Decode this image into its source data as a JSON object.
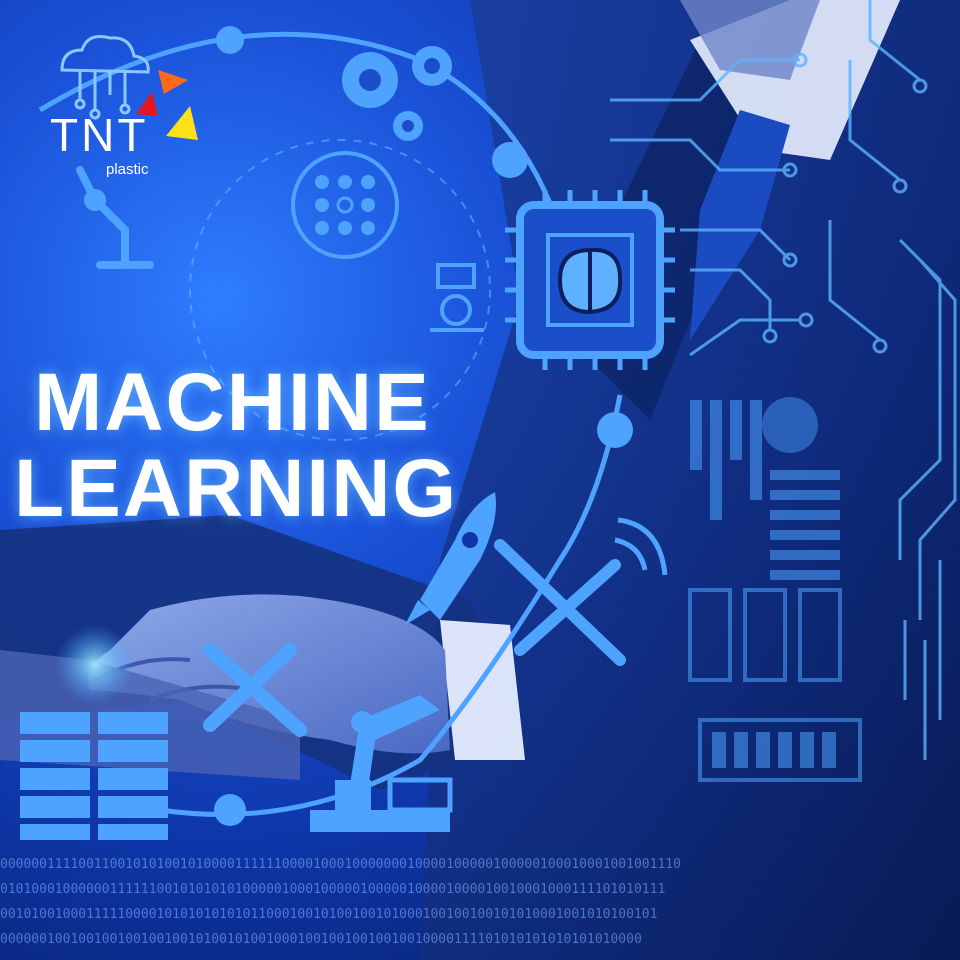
{
  "logo": {
    "brand": "TNT",
    "sub": "plastic",
    "colors": {
      "orange": "#ff6a1a",
      "red": "#e8141e",
      "yellow": "#ffe11a"
    }
  },
  "headline": {
    "line1": "MACHINE",
    "line2": "LEARNING"
  },
  "binary_rows": [
    "000000111100110010101001010000111111000010001000000010000100000100000100010001001001110",
    "0101000100000011111100101010101000001000100000100000100001000010010001000111101010111",
    "001010010001111100001010101010101100010010100100101000100100100101010001001010100101",
    "0000001001001001001001001010010100100010010010010010010000111101010101010101010000"
  ],
  "icons": [
    "cloud-network-icon",
    "gears-icon",
    "robot-arm-icon",
    "flowchart-icon",
    "brain-chip-icon",
    "robot-icon",
    "rocket-icon",
    "satellite-icon",
    "wifi-icon",
    "wrench-icon",
    "database-icon",
    "industrial-robot-icon"
  ]
}
